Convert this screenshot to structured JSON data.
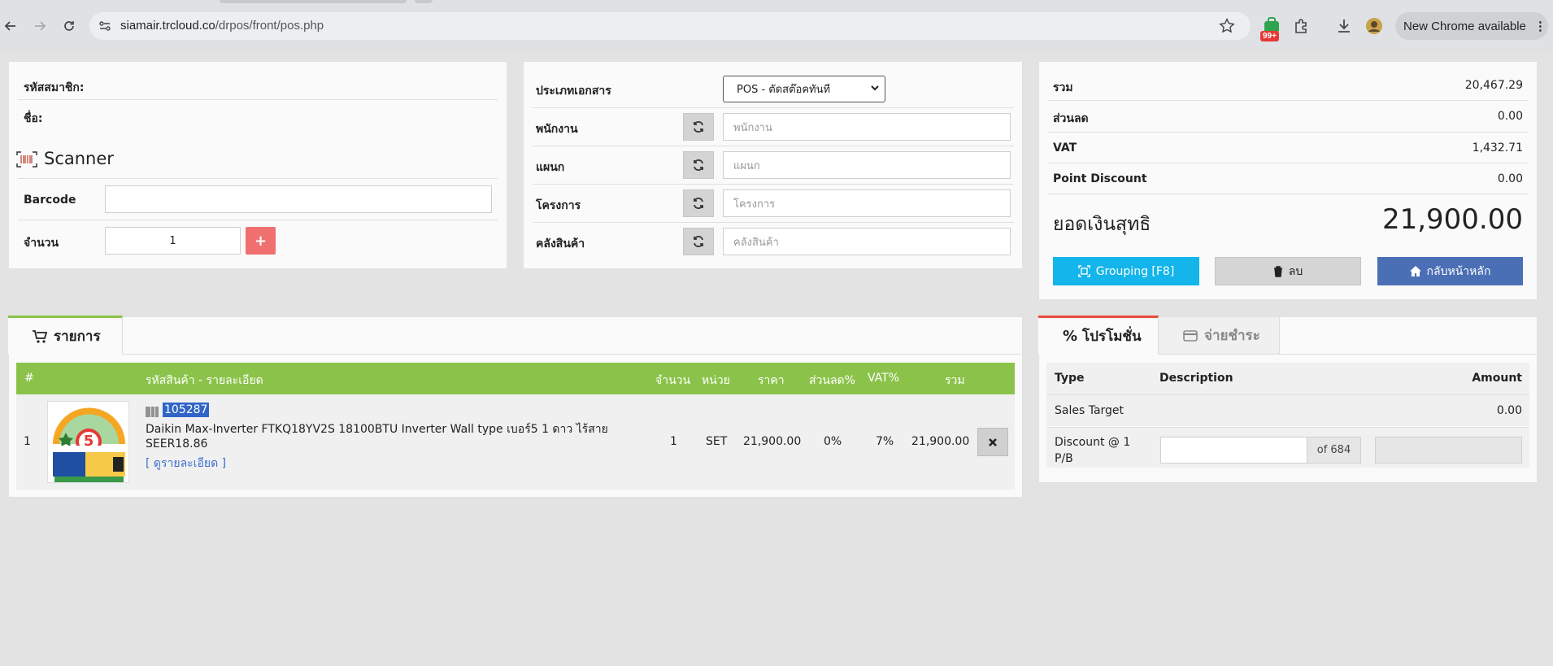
{
  "browser": {
    "url_host": "siamair.trcloud.co",
    "url_path": "/drpos/front/pos.php",
    "notifications_badge": "99+",
    "update_label": "New Chrome available"
  },
  "member": {
    "code_label": "รหัสสมาชิก:",
    "name_label": "ชื่อ:",
    "scanner_title": "Scanner",
    "barcode_label": "Barcode",
    "barcode_value": "",
    "qty_label": "จำนวน",
    "qty_value": "1",
    "add_symbol": "+"
  },
  "doc": {
    "type_label": "ประเภทเอกสาร",
    "type_selected": "POS - ตัดสต๊อคทันที",
    "employee_label": "พนักงาน",
    "employee_placeholder": "พนักงาน",
    "department_label": "แผนก",
    "department_placeholder": "แผนก",
    "project_label": "โครงการ",
    "project_placeholder": "โครงการ",
    "warehouse_label": "คลังสินค้า",
    "warehouse_placeholder": "คลังสินค้า"
  },
  "summary": {
    "total_label": "รวม",
    "total_value": "20,467.29",
    "discount_label": "ส่วนลด",
    "discount_value": "0.00",
    "vat_label": "VAT",
    "vat_value": "1,432.71",
    "point_label": "Point Discount",
    "point_value": "0.00",
    "net_label": "ยอดเงินสุทธิ",
    "net_value": "21,900.00",
    "grouping_label": "Grouping [F8]",
    "delete_label": "ลบ",
    "home_label": "กลับหน้าหลัก"
  },
  "items": {
    "tab_label": "รายการ",
    "headers": {
      "num": "#",
      "code": "รหัสสินค้า - รายละเอียด",
      "qty": "จำนวน",
      "unit": "หน่วย",
      "price": "ราคา",
      "discount": "ส่วนลด%",
      "vat": "VAT%",
      "total": "รวม"
    },
    "rows": [
      {
        "num": "1",
        "code": "105287",
        "name_line1": "Daikin Max-Inverter FTKQ18YV2S 18100BTU Inverter Wall type เบอร์5 1 ดาว ไร้สาย",
        "name_line2": "SEER18.86",
        "detail_link": "[ ดูรายละเอียด ]",
        "qty": "1",
        "unit": "SET",
        "price": "21,900.00",
        "discount": "0%",
        "vat": "7%",
        "total": "21,900.00",
        "label_number": "5"
      }
    ]
  },
  "promo": {
    "tab_promo": "โปรโมชั่น",
    "tab_payment": "จ่ายชำระ",
    "col_type": "Type",
    "col_description": "Description",
    "col_amount": "Amount",
    "rows": [
      {
        "type": "Sales Target",
        "amount": "0.00"
      },
      {
        "type": "Discount @ 1 P/B",
        "of_label": "of 684"
      }
    ]
  },
  "colors": {
    "green_header": "#8bc34a",
    "grouping_btn": "#13b5ea",
    "home_btn": "#4a6fb5",
    "add_btn": "#f07070",
    "promo_tab_accent": "#e74c3c"
  }
}
